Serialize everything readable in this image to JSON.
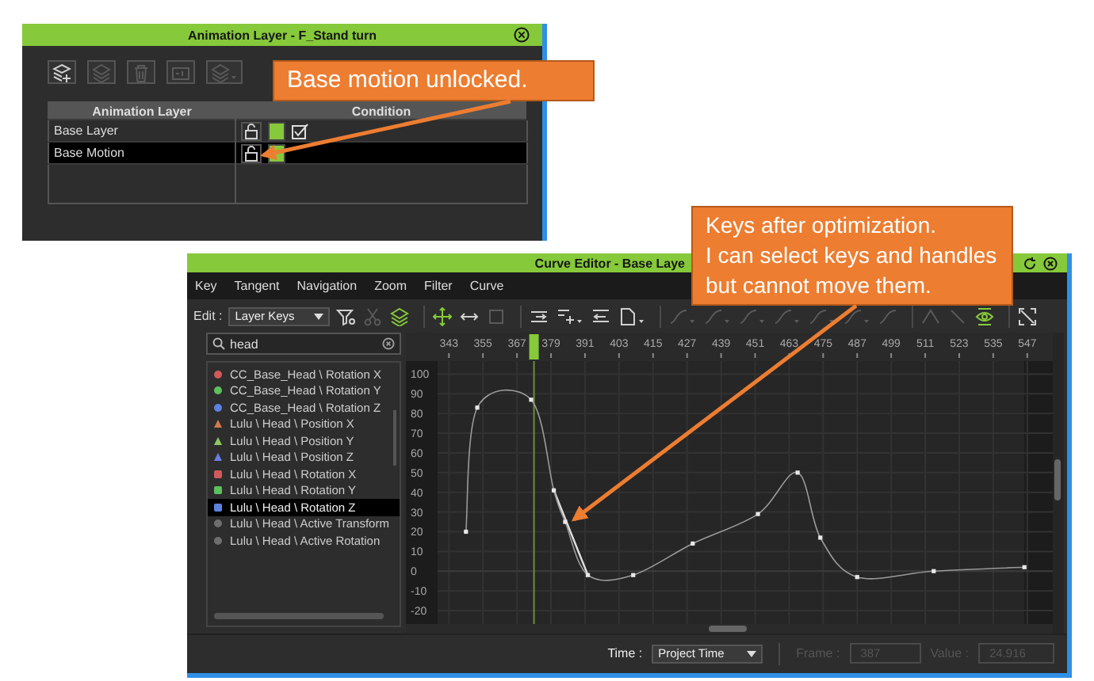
{
  "layer_window": {
    "title": "Animation Layer - F_Stand turn",
    "tools": [
      {
        "kind": "add-layer",
        "disabled": false,
        "caret": false
      },
      {
        "kind": "layer",
        "disabled": true,
        "caret": false
      },
      {
        "kind": "trash",
        "disabled": true,
        "caret": false
      },
      {
        "kind": "key",
        "disabled": true,
        "caret": false
      },
      {
        "kind": "layer-menu",
        "disabled": true,
        "caret": true
      }
    ],
    "table": {
      "columns": [
        "Animation Layer",
        "Condition"
      ],
      "rows": [
        {
          "name": "Base Layer",
          "selected": false,
          "locked": false,
          "checked": true
        },
        {
          "name": "Base Motion",
          "selected": true,
          "locked": false,
          "checked": false
        }
      ]
    }
  },
  "curve_window": {
    "title": "Curve Editor - Base Laye",
    "menu": [
      "Key",
      "Tangent",
      "Navigation",
      "Zoom",
      "Filter",
      "Curve"
    ],
    "edit_label": "Edit :",
    "edit_mode": "Layer Keys",
    "tool_groups": [
      [
        {
          "kind": "filter",
          "disabled": false,
          "caret": false
        },
        {
          "kind": "scissors",
          "disabled": true,
          "caret": false
        },
        {
          "kind": "layers",
          "disabled": false,
          "caret": false
        }
      ],
      [
        {
          "kind": "move",
          "disabled": false,
          "caret": false
        },
        {
          "kind": "arrows",
          "disabled": false,
          "caret": false
        },
        {
          "kind": "square",
          "disabled": true,
          "caret": false
        }
      ],
      [
        {
          "kind": "align",
          "disabled": false,
          "caret": false
        },
        {
          "kind": "insert",
          "disabled": false,
          "caret": true
        },
        {
          "kind": "snap",
          "disabled": false,
          "caret": false
        },
        {
          "kind": "page",
          "disabled": false,
          "caret": true
        }
      ],
      [
        {
          "kind": "tangent",
          "disabled": true,
          "caret": true
        },
        {
          "kind": "tangent",
          "disabled": true,
          "caret": true
        },
        {
          "kind": "tangent",
          "disabled": true,
          "caret": true
        },
        {
          "kind": "tangent",
          "disabled": true,
          "caret": true
        },
        {
          "kind": "tangent",
          "disabled": true,
          "caret": true
        },
        {
          "kind": "tangent",
          "disabled": true,
          "caret": true
        },
        {
          "kind": "tangent",
          "disabled": true,
          "caret": false
        }
      ],
      [
        {
          "kind": "peak",
          "disabled": true,
          "caret": false
        },
        {
          "kind": "slope",
          "disabled": true,
          "caret": false
        },
        {
          "kind": "eye",
          "disabled": false,
          "caret": false
        }
      ],
      [
        {
          "kind": "expand",
          "disabled": false,
          "caret": false
        }
      ]
    ],
    "search": {
      "value": "head"
    },
    "channels": [
      {
        "name": "CC_Base_Head \\ Rotation X",
        "kind": "dot",
        "color": "#d05a5a",
        "selected": false
      },
      {
        "name": "CC_Base_Head \\ Rotation Y",
        "kind": "dot",
        "color": "#5cc05c",
        "selected": false
      },
      {
        "name": "CC_Base_Head \\ Rotation Z",
        "kind": "dot",
        "color": "#5a82e0",
        "selected": false
      },
      {
        "name": "Lulu \\ Head \\ Position X",
        "kind": "triangle",
        "color": "#d0784a",
        "selected": false
      },
      {
        "name": "Lulu \\ Head \\ Position Y",
        "kind": "triangle",
        "color": "#8cc864",
        "selected": false
      },
      {
        "name": "Lulu \\ Head \\ Position Z",
        "kind": "triangle",
        "color": "#6a7ee0",
        "selected": false
      },
      {
        "name": "Lulu \\ Head \\ Rotation X",
        "kind": "square",
        "color": "#d05a5a",
        "selected": false
      },
      {
        "name": "Lulu \\ Head \\ Rotation Y",
        "kind": "square",
        "color": "#5cc05c",
        "selected": false
      },
      {
        "name": "Lulu \\ Head \\ Rotation Z",
        "kind": "square",
        "color": "#5a82e0",
        "selected": true
      },
      {
        "name": "Lulu \\ Head \\ Active Transform",
        "kind": "dot",
        "color": "#6e6e6e",
        "selected": false
      },
      {
        "name": "Lulu \\ Head \\ Active Rotation",
        "kind": "dot",
        "color": "#6e6e6e",
        "selected": false
      }
    ],
    "graph": {
      "chart_data": {
        "type": "line",
        "x": [
          349,
          353,
          372,
          380,
          384,
          392,
          408,
          429,
          452,
          466,
          474,
          487,
          514,
          546
        ],
        "series": [
          {
            "color": "#9a9a9a",
            "marker": "square",
            "values": [
              20,
              83,
              87,
              41,
              25,
              -2,
              -2,
              14,
              29,
              50,
              17,
              -3,
              0,
              2
            ]
          }
        ],
        "grid": true,
        "xlim": [
          339,
          556
        ],
        "ylim": [
          -22,
          105
        ],
        "xticks": [
          343,
          355,
          367,
          379,
          391,
          403,
          415,
          427,
          439,
          451,
          463,
          475,
          487,
          499,
          511,
          523,
          535,
          547
        ],
        "yticks": [
          100,
          90,
          80,
          70,
          60,
          50,
          40,
          30,
          20,
          10,
          0,
          -10,
          -20
        ],
        "ref_lines": [
          {
            "axis": "x",
            "value": 373
          }
        ]
      }
    },
    "footer": {
      "time_label": "Time :",
      "time_mode": "Project Time",
      "frame": {
        "label": "Frame :",
        "value": "387",
        "disabled": true
      },
      "value": {
        "label": "Value :",
        "value": "24.916",
        "disabled": true
      }
    }
  },
  "callouts": [
    {
      "text": "Base motion unlocked."
    },
    {
      "text": "Keys after optimization.\nI can select keys and handles\nbut cannot move them."
    }
  ]
}
